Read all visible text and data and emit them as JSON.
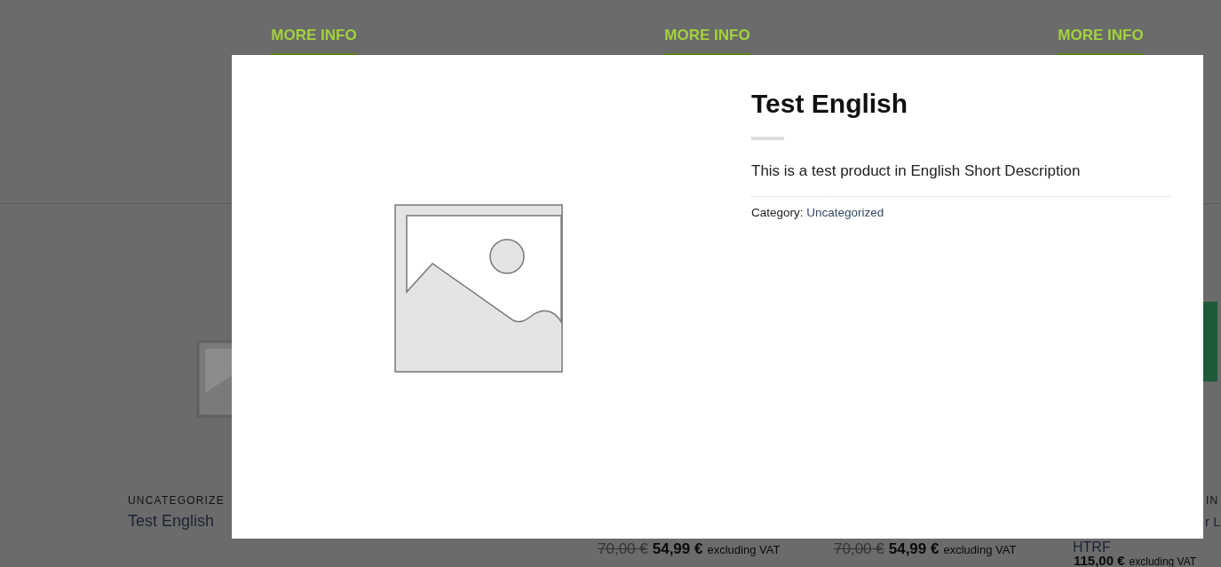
{
  "background": {
    "more_info_buttons": [
      "MORE INFO",
      "MORE INFO",
      "MORE INFO"
    ],
    "products": [
      {
        "kind": "placeholder",
        "category": "UNCATEGORIZE",
        "title": "Test English"
      },
      {
        "kind": "sale",
        "old_price": "70,00 €",
        "price": "54,99 €",
        "tax_note": "excluding VAT"
      },
      {
        "kind": "sale",
        "old_price": "70,00 €",
        "price": "54,99 €",
        "tax_note": "excluding VAT"
      },
      {
        "kind": "photo",
        "category": "IN",
        "title": "r L",
        "title_line_2": "HTRF",
        "price": "115,00 €",
        "tax_note": "excluding VAT"
      }
    ]
  },
  "modal": {
    "title": "Test English",
    "description": "This is a test product in English Short Description",
    "category_label": "Category:",
    "category_link": "Uncategorized"
  }
}
